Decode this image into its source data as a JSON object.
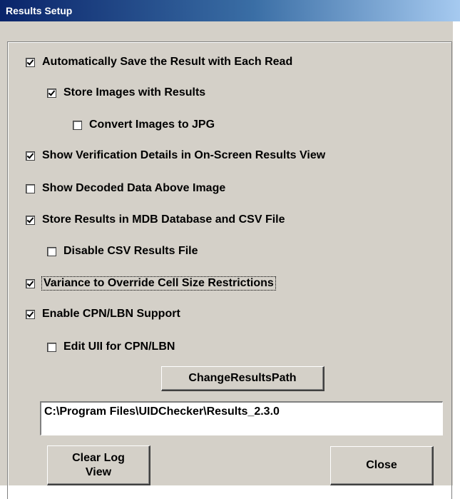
{
  "window": {
    "title": "Results Setup"
  },
  "options": [
    {
      "label": "Automatically Save the Result with Each Read",
      "checked": true
    },
    {
      "label": "Store Images with Results",
      "checked": true
    },
    {
      "label": "Convert Images to JPG",
      "checked": false
    },
    {
      "label": "Show Verification Details in On-Screen Results View",
      "checked": true
    },
    {
      "label": "Show Decoded Data Above Image",
      "checked": false
    },
    {
      "label": "Store Results in MDB Database and CSV File",
      "checked": true
    },
    {
      "label": "Disable CSV Results File",
      "checked": false
    },
    {
      "label": "Variance to Override Cell Size Restrictions",
      "checked": true
    },
    {
      "label": "Enable CPN/LBN Support",
      "checked": true
    },
    {
      "label": "Edit UII for CPN/LBN",
      "checked": false
    }
  ],
  "buttons": {
    "change_path": "ChangeResultsPath",
    "clear_log_line1": "Clear Log",
    "clear_log_line2": "View",
    "close": "Close"
  },
  "results_path": {
    "value": "C:\\Program Files\\UIDChecker\\Results_2.3.0"
  }
}
